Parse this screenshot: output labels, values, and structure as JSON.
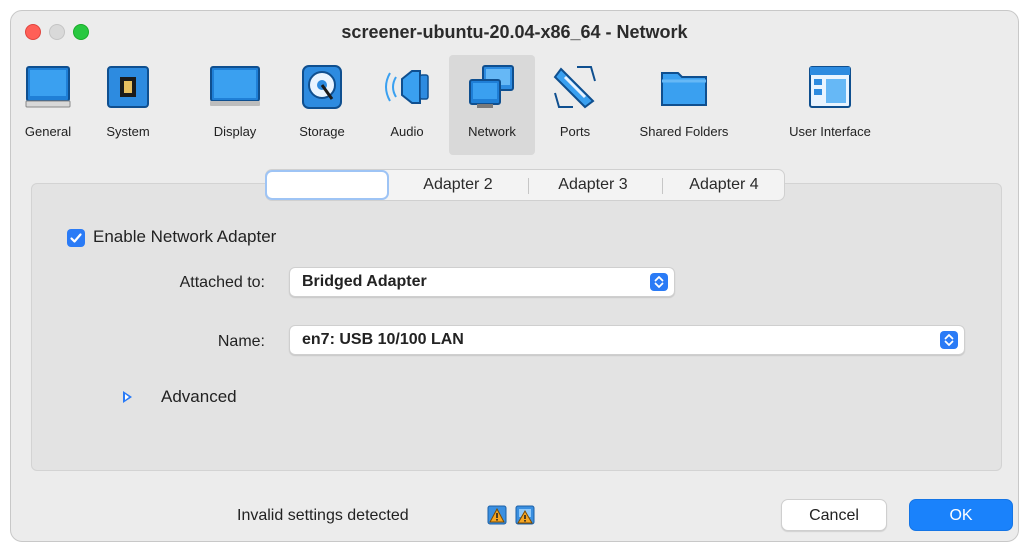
{
  "window": {
    "title": "screener-ubuntu-20.04-x86_64 - Network"
  },
  "toolbar": {
    "items": [
      {
        "label": "General",
        "icon": "monitor-icon"
      },
      {
        "label": "System",
        "icon": "chip-icon"
      },
      {
        "label": "Display",
        "icon": "display-icon"
      },
      {
        "label": "Storage",
        "icon": "disk-icon"
      },
      {
        "label": "Audio",
        "icon": "speaker-icon"
      },
      {
        "label": "Network",
        "icon": "network-icon",
        "selected": true
      },
      {
        "label": "Ports",
        "icon": "ports-icon"
      },
      {
        "label": "Shared Folders",
        "icon": "folder-icon"
      },
      {
        "label": "User Interface",
        "icon": "window-icon"
      }
    ]
  },
  "tabs": {
    "items": [
      "",
      "Adapter 2",
      "Adapter 3",
      "Adapter 4"
    ],
    "active_index": 0
  },
  "adapter": {
    "enable_label": "Enable Network Adapter",
    "enabled": true,
    "attached_to_label": "Attached to:",
    "attached_to_value": "Bridged Adapter",
    "name_label": "Name:",
    "name_value": "en7: USB 10/100 LAN",
    "advanced_label": "Advanced"
  },
  "footer": {
    "status_text": "Invalid settings detected",
    "cancel_label": "Cancel",
    "ok_label": "OK"
  },
  "colors": {
    "accent": "#1a82fb",
    "close": "#ff5f57",
    "maximize": "#28c840",
    "warning": "#f5a623"
  }
}
